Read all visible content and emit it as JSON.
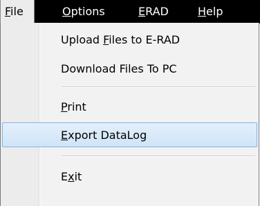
{
  "menubar": {
    "items": [
      {
        "accel": "F",
        "rest": "ile"
      },
      {
        "accel": "O",
        "rest": "ptions"
      },
      {
        "accel": "E",
        "rest": "RAD"
      },
      {
        "accel": "H",
        "rest": "elp"
      }
    ]
  },
  "file_menu": {
    "items": [
      {
        "before": "Upload ",
        "accel": "F",
        "after": "iles to E-RAD"
      },
      {
        "before": "Download Files To PC",
        "accel": "",
        "after": ""
      },
      {
        "before": "",
        "accel": "P",
        "after": "rint"
      },
      {
        "before": "",
        "accel": "E",
        "after": "xport DataLog"
      },
      {
        "before": "E",
        "accel": "x",
        "after": "it"
      }
    ],
    "highlighted_item": "Export DataLog"
  },
  "colors": {
    "menubar_bg": "#000000",
    "highlight_border": "#7eb4ea"
  }
}
